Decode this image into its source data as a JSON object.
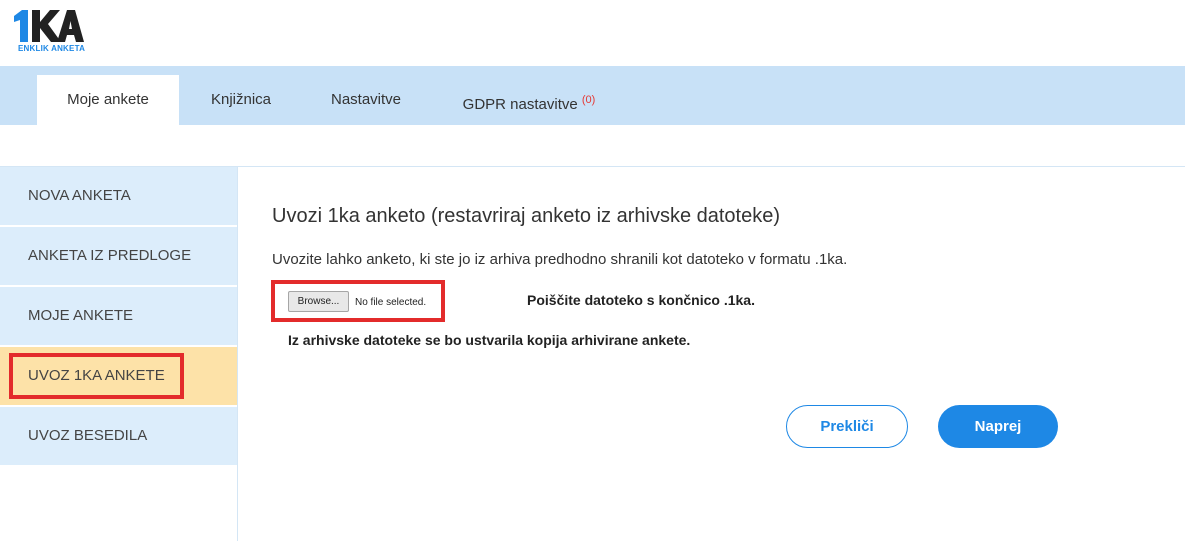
{
  "logo": {
    "mark": "1KA",
    "subtitle": "ENKLIK ANKETA",
    "mark_color_dark": "#222222",
    "mark_color_accent": "#1e88e5"
  },
  "nav": {
    "tabs": [
      {
        "label": "Moje ankete",
        "active": true
      },
      {
        "label": "Knjižnica"
      },
      {
        "label": "Nastavitve"
      },
      {
        "label": "GDPR nastavitve",
        "badge": "(0)"
      }
    ]
  },
  "sidebar": {
    "items": [
      {
        "label": "NOVA ANKETA"
      },
      {
        "label": "ANKETA IZ PREDLOGE"
      },
      {
        "label": "MOJE ANKETE"
      },
      {
        "label": "UVOZ 1KA ANKETE",
        "active": true
      },
      {
        "label": "UVOZ BESEDILA"
      }
    ]
  },
  "main": {
    "title": "Uvozi 1ka anketo (restavriraj anketo iz arhivske datoteke)",
    "description": "Uvozite lahko anketo, ki ste jo iz arhiva predhodno shranili kot datoteko v formatu .1ka.",
    "file_input": {
      "button_label": "Browse...",
      "status": "No file selected."
    },
    "hint": "Poiščite datoteko s končnico .1ka.",
    "note": "Iz arhivske datoteke se bo ustvarila kopija arhivirane ankete.",
    "cancel_label": "Prekliči",
    "next_label": "Naprej"
  },
  "colors": {
    "accent": "#1e88e5",
    "nav_bg": "#c8e1f7",
    "sidebar_bg": "#dcedfb",
    "sidebar_active_bg": "#fde2a8",
    "highlight": "#e32b2b"
  }
}
